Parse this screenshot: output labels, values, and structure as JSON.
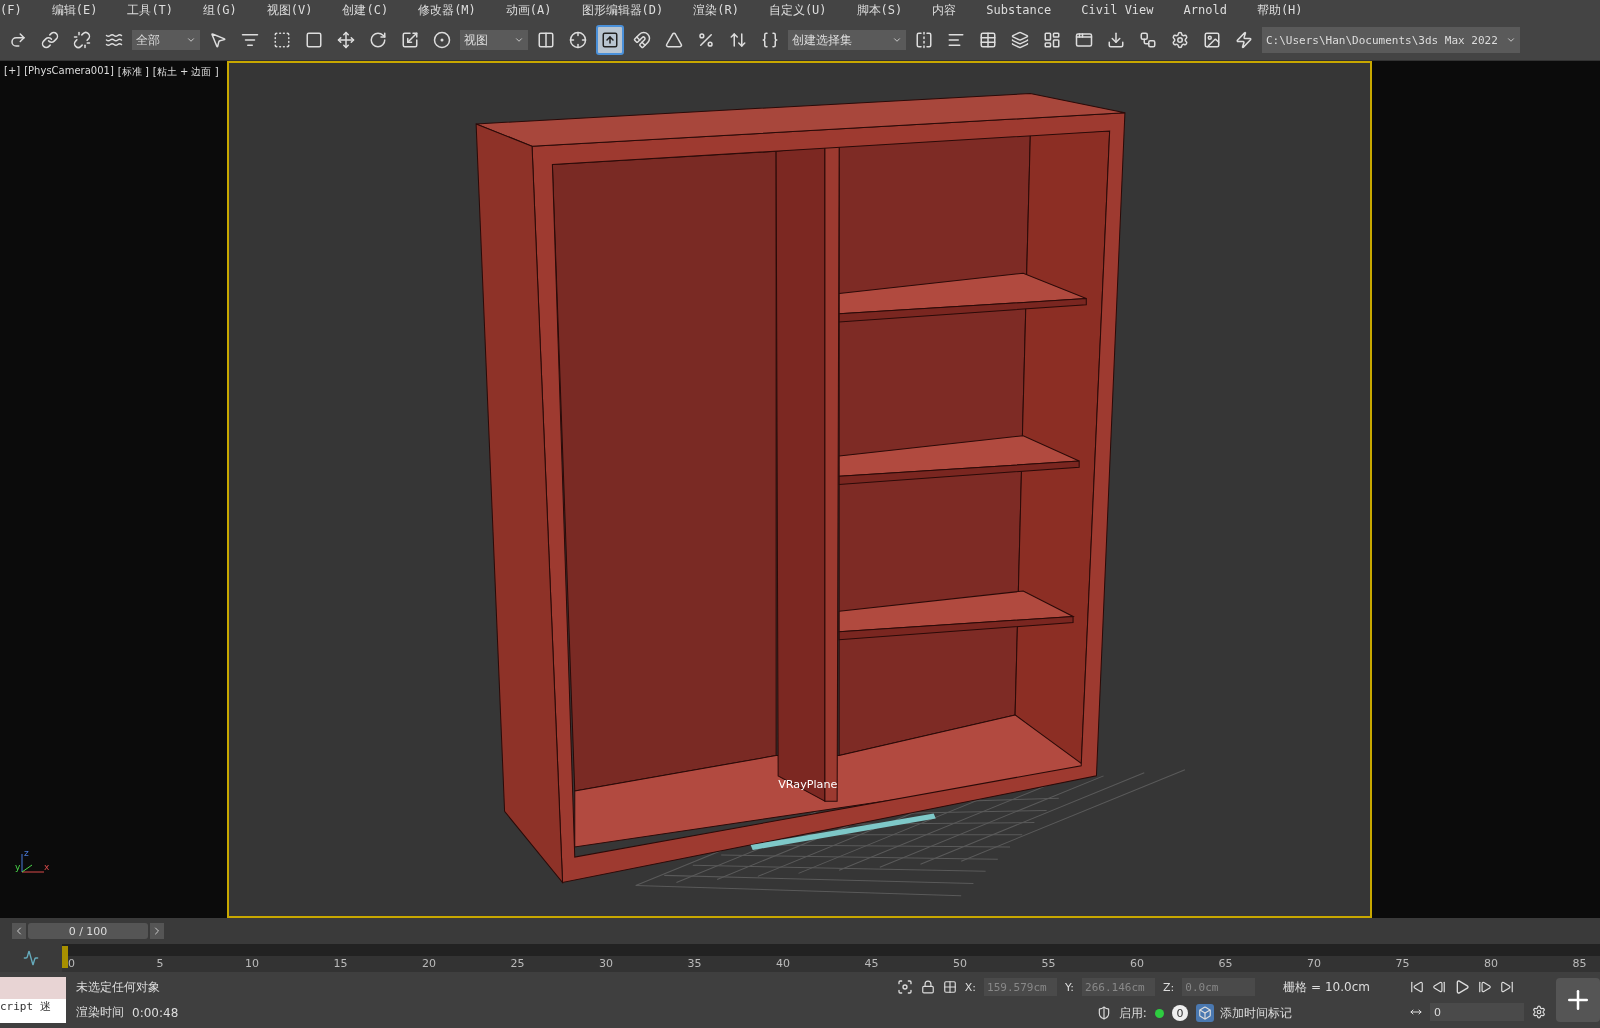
{
  "menu": [
    "(F)",
    "编辑(E)",
    "工具(T)",
    "组(G)",
    "视图(V)",
    "创建(C)",
    "修改器(M)",
    "动画(A)",
    "图形编辑器(D)",
    "渲染(R)",
    "自定义(U)",
    "脚本(S)",
    "内容",
    "Substance",
    "Civil View",
    "Arnold",
    "帮助(H)"
  ],
  "toolbar": [
    {
      "kind": "icon",
      "selected": false
    },
    {
      "kind": "icon",
      "selected": false
    },
    {
      "kind": "icon",
      "selected": false
    },
    {
      "kind": "icon",
      "selected": false
    },
    {
      "kind": "dropdown",
      "value": "全部"
    },
    {
      "kind": "icon",
      "selected": false
    },
    {
      "kind": "icon",
      "selected": false
    },
    {
      "kind": "icon",
      "selected": false
    },
    {
      "kind": "icon",
      "selected": false
    },
    {
      "kind": "icon",
      "selected": false
    },
    {
      "kind": "icon",
      "selected": false
    },
    {
      "kind": "icon",
      "selected": false
    },
    {
      "kind": "icon",
      "selected": false
    },
    {
      "kind": "dropdown",
      "value": "视图"
    },
    {
      "kind": "icon",
      "selected": false
    },
    {
      "kind": "icon",
      "selected": false
    },
    {
      "kind": "icon",
      "selected": true
    },
    {
      "kind": "icon",
      "selected": false
    },
    {
      "kind": "icon",
      "selected": false
    },
    {
      "kind": "icon",
      "selected": false
    },
    {
      "kind": "icon",
      "selected": false
    },
    {
      "kind": "icon",
      "selected": false
    },
    {
      "kind": "dropdown",
      "value": "创建选择集"
    },
    {
      "kind": "icon",
      "selected": false
    },
    {
      "kind": "icon",
      "selected": false
    },
    {
      "kind": "icon",
      "selected": false
    },
    {
      "kind": "icon",
      "selected": false
    },
    {
      "kind": "icon",
      "selected": false
    },
    {
      "kind": "icon",
      "selected": false
    },
    {
      "kind": "icon",
      "selected": false
    },
    {
      "kind": "icon",
      "selected": false
    },
    {
      "kind": "icon",
      "selected": false
    },
    {
      "kind": "icon",
      "selected": false
    },
    {
      "kind": "icon",
      "selected": false
    },
    {
      "kind": "path",
      "value": "C:\\Users\\Han\\Documents\\3ds Max 2022"
    }
  ],
  "viewport": {
    "labels": [
      "[+]",
      "[PhysCamera001]",
      "[标准 ]",
      "[粘土 + 边面 ]"
    ],
    "object_label": "VRayPlane",
    "axes": [
      "z",
      "y",
      "x"
    ]
  },
  "timeline": {
    "frame": "0 / 100",
    "level": 0,
    "ticks": [
      "0",
      "5",
      "10",
      "15",
      "20",
      "25",
      "30",
      "35",
      "40",
      "45",
      "50",
      "55",
      "60",
      "65",
      "70",
      "75",
      "80",
      "85"
    ]
  },
  "status": {
    "script": "cript 迷",
    "selection": "未选定任何对象",
    "render_label": "渲染时间",
    "render_time": "0:00:48",
    "x_label": "X:",
    "x": "159.579cm",
    "y_label": "Y:",
    "y": "266.146cm",
    "z_label": "Z:",
    "z": "0.0cm",
    "grid": "栅格 = 10.0cm",
    "enable": "启用:",
    "enable_on": true,
    "count": "0",
    "add_tag": "添加时间标记",
    "frame_field": "0"
  }
}
